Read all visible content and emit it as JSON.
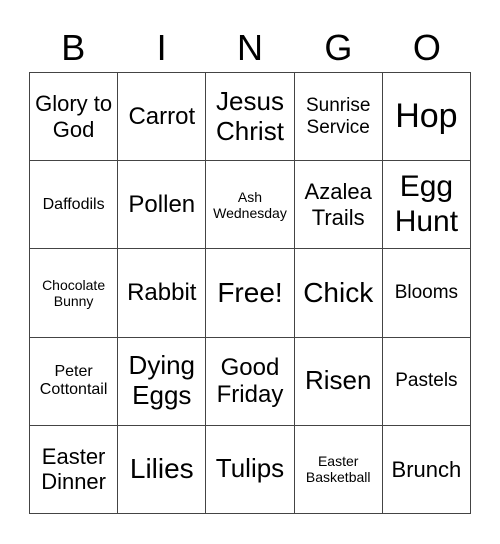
{
  "header": [
    "B",
    "I",
    "N",
    "G",
    "O"
  ],
  "cells": [
    "Glory to God",
    "Carrot",
    "Jesus Christ",
    "Sunrise Service",
    "Hop",
    "Daffodils",
    "Pollen",
    "Ash Wednesday",
    "Azalea Trails",
    "Egg Hunt",
    "Chocolate Bunny",
    "Rabbit",
    "Free!",
    "Chick",
    "Blooms",
    "Peter Cottontail",
    "Dying Eggs",
    "Good Friday",
    "Risen",
    "Pastels",
    "Easter Dinner",
    "Lilies",
    "Tulips",
    "Easter Basketball",
    "Brunch"
  ]
}
